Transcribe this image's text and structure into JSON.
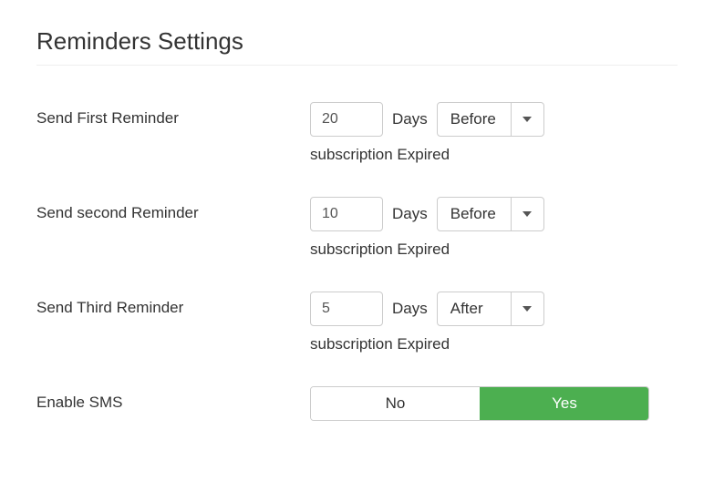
{
  "title": "Reminders Settings",
  "reminders": [
    {
      "label": "Send First Reminder",
      "days": "20",
      "days_unit": "Days",
      "timing": "Before",
      "helper": "subscription Expired"
    },
    {
      "label": "Send second Reminder",
      "days": "10",
      "days_unit": "Days",
      "timing": "Before",
      "helper": "subscription Expired"
    },
    {
      "label": "Send Third Reminder",
      "days": "5",
      "days_unit": "Days",
      "timing": "After",
      "helper": "subscription Expired"
    }
  ],
  "sms": {
    "label": "Enable SMS",
    "options": {
      "no": "No",
      "yes": "Yes"
    },
    "active": "yes"
  }
}
